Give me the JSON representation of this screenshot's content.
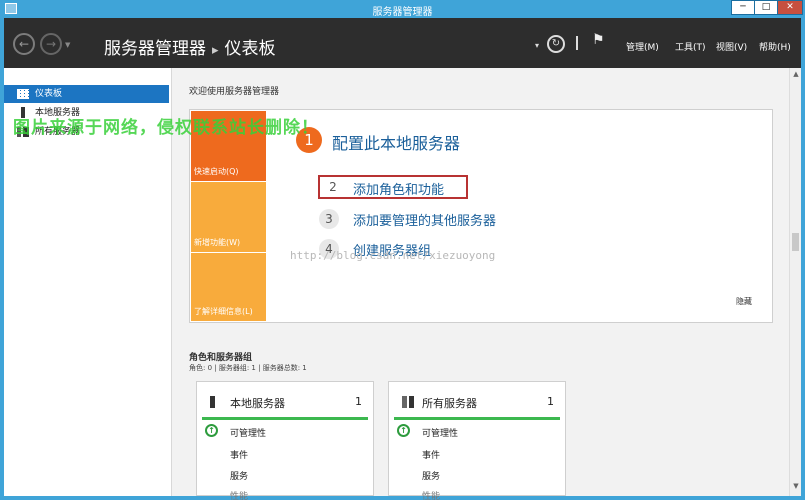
{
  "window": {
    "title": "服务器管理器",
    "min": "─",
    "max": "□",
    "close": "✕"
  },
  "header": {
    "breadcrumb_root": "服务器管理器",
    "breadcrumb_sep": "▸",
    "breadcrumb_current": "仪表板",
    "menus": [
      "管理(M)",
      "工具(T)",
      "视图(V)",
      "帮助(H)"
    ]
  },
  "sidebar": {
    "items": [
      {
        "label": "仪表板",
        "active": true,
        "icon": "dashboard-icon"
      },
      {
        "label": "本地服务器",
        "active": false,
        "icon": "server-icon"
      },
      {
        "label": "所有服务器",
        "active": false,
        "icon": "servers-icon"
      }
    ]
  },
  "welcome": {
    "heading": "欢迎使用服务器管理器",
    "tiles": [
      "快速启动(Q)",
      "新增功能(W)",
      "了解详细信息(L)"
    ],
    "step1": {
      "num": "1",
      "label": "配置此本地服务器"
    },
    "steps": [
      {
        "num": "2",
        "label": "添加角色和功能"
      },
      {
        "num": "3",
        "label": "添加要管理的其他服务器"
      },
      {
        "num": "4",
        "label": "创建服务器组"
      }
    ],
    "hide": "隐藏",
    "url_watermark": "http://blog.csdn.net/xiezuoyong"
  },
  "roles": {
    "title": "角色和服务器组",
    "subtitle": "角色: 0 | 服务器组: 1 | 服务器总数: 1",
    "cards": [
      {
        "title": "本地服务器",
        "count": "1",
        "rows": [
          "可管理性",
          "事件",
          "服务",
          "性能"
        ]
      },
      {
        "title": "所有服务器",
        "count": "1",
        "rows": [
          "可管理性",
          "事件",
          "服务",
          "性能"
        ]
      }
    ]
  },
  "overlay_watermark": "图片来源于网络，侵权联系站长删除！",
  "colors": {
    "accent": "#1c75c2",
    "orange": "#ee6a1e",
    "light_orange": "#f8ab3c",
    "green": "#3cb84f",
    "title_bar": "#3fa4d8"
  }
}
